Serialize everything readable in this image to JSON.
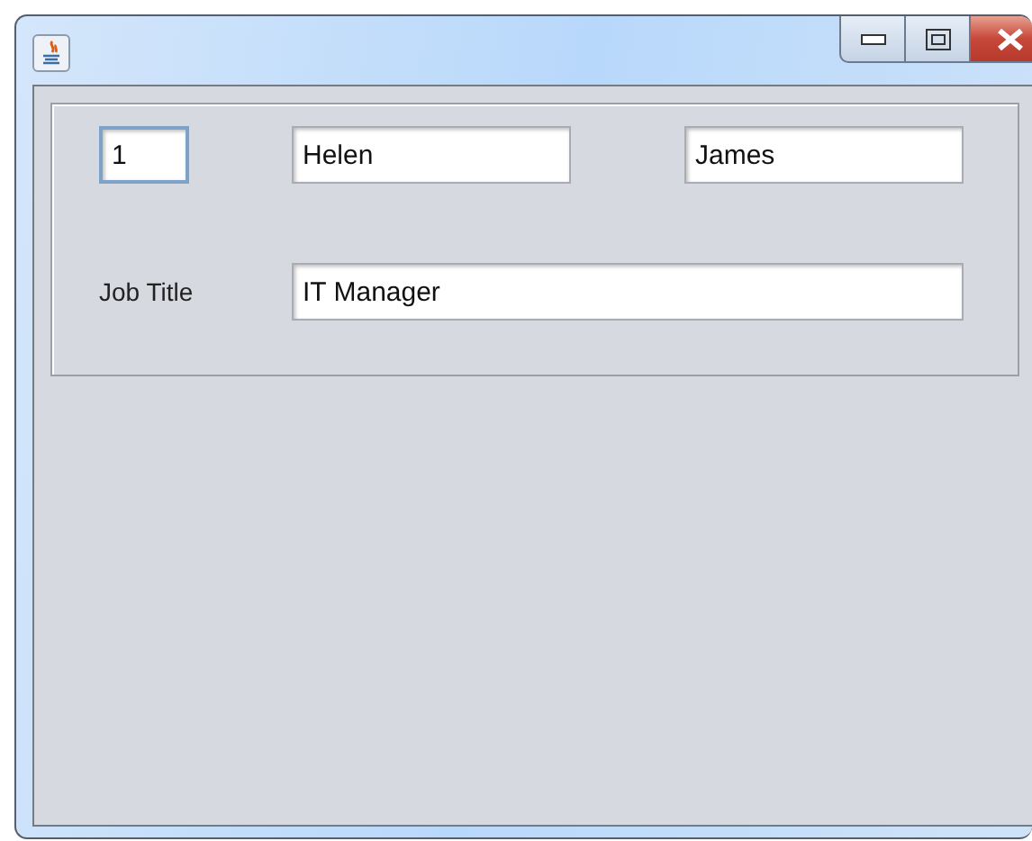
{
  "window": {
    "controls": [
      {
        "kind": "minimize"
      },
      {
        "kind": "maximize"
      },
      {
        "kind": "close"
      }
    ]
  },
  "row_1": [
    {
      "value": "1",
      "focused": true
    },
    {
      "value": "Helen",
      "focused": false
    },
    {
      "value": "James",
      "focused": false
    }
  ],
  "job_title": {
    "label": "Job Title",
    "value": "IT Manager",
    "focused": false
  }
}
